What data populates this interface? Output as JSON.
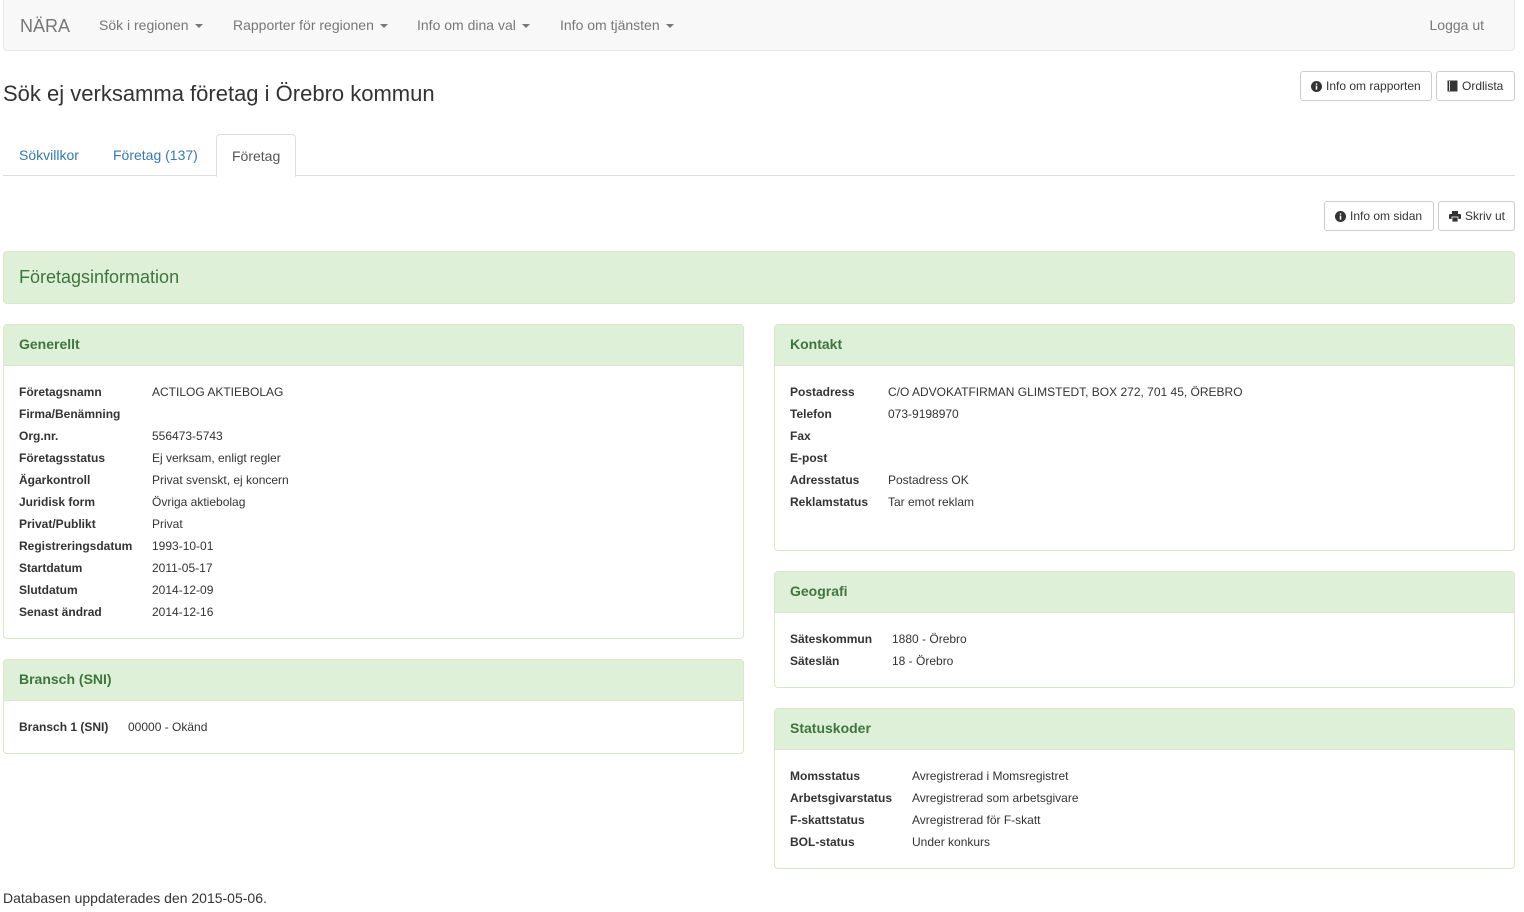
{
  "navbar": {
    "brand": "NÄRA",
    "items": [
      "Sök i regionen",
      "Rapporter för regionen",
      "Info om dina val",
      "Info om tjänsten"
    ],
    "logout": "Logga ut"
  },
  "page": {
    "title": "Sök ej verksamma företag i Örebro kommun",
    "btn_info_report": "Info om rapporten",
    "btn_glossary": "Ordlista",
    "btn_info_page": "Info om sidan",
    "btn_print": "Skriv ut"
  },
  "tabs": [
    {
      "label": "Sökvillkor"
    },
    {
      "label": "Företag (137)"
    },
    {
      "label": "Företag"
    }
  ],
  "company_info_title": "Företagsinformation",
  "generellt": {
    "title": "Generellt",
    "rows": [
      {
        "label": "Företagsnamn",
        "value": "ACTILOG AKTIEBOLAG"
      },
      {
        "label": "Firma/Benämning",
        "value": ""
      },
      {
        "label": "Org.nr.",
        "value": "556473-5743"
      },
      {
        "label": "Företagsstatus",
        "value": "Ej verksam, enligt regler"
      },
      {
        "label": "Ägarkontroll",
        "value": "Privat svenskt, ej koncern"
      },
      {
        "label": "Juridisk form",
        "value": "Övriga aktiebolag"
      },
      {
        "label": "Privat/Publikt",
        "value": "Privat"
      },
      {
        "label": "Registreringsdatum",
        "value": "1993-10-01"
      },
      {
        "label": "Startdatum",
        "value": "2011-05-17"
      },
      {
        "label": "Slutdatum",
        "value": "2014-12-09"
      },
      {
        "label": "Senast ändrad",
        "value": "2014-12-16"
      }
    ]
  },
  "bransch": {
    "title": "Bransch (SNI)",
    "rows": [
      {
        "label": "Bransch 1 (SNI)",
        "value": "00000 - Okänd"
      }
    ]
  },
  "kontakt": {
    "title": "Kontakt",
    "rows": [
      {
        "label": "Postadress",
        "value": "C/O ADVOKATFIRMAN GLIMSTEDT, BOX 272, 701 45, ÖREBRO"
      },
      {
        "label": "Telefon",
        "value": "073-9198970"
      },
      {
        "label": "Fax",
        "value": ""
      },
      {
        "label": "E-post",
        "value": ""
      },
      {
        "label": "Adresstatus",
        "value": "Postadress OK"
      },
      {
        "label": "Reklamstatus",
        "value": "Tar emot reklam"
      }
    ]
  },
  "geografi": {
    "title": "Geografi",
    "rows": [
      {
        "label": "Säteskommun",
        "value": "1880 - Örebro"
      },
      {
        "label": "Säteslän",
        "value": "18 - Örebro"
      }
    ]
  },
  "statuskoder": {
    "title": "Statuskoder",
    "rows": [
      {
        "label": "Momsstatus",
        "value": "Avregistrerad i Momsregistret"
      },
      {
        "label": "Arbetsgivarstatus",
        "value": "Avregistrerad som arbetsgivare"
      },
      {
        "label": "F-skattstatus",
        "value": "Avregistrerad för F-skatt"
      },
      {
        "label": "BOL-status",
        "value": "Under konkurs"
      }
    ]
  },
  "footer": "Databasen uppdaterades den 2015-05-06."
}
